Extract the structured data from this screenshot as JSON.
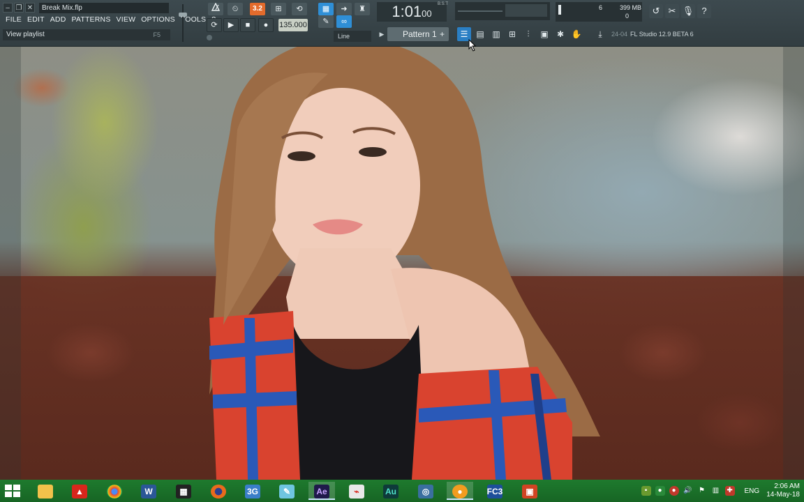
{
  "window": {
    "file_title": "Break Mix.flp",
    "ctrl_minimize": "–",
    "ctrl_restore": "❐",
    "ctrl_close": "✕"
  },
  "menu": [
    "FILE",
    "EDIT",
    "ADD",
    "PATTERNS",
    "VIEW",
    "OPTIONS",
    "TOOLS",
    "?"
  ],
  "hint": {
    "text": "View playlist",
    "shortcut": "F5"
  },
  "toolbar": {
    "tempo": "135.000",
    "snap": "Line",
    "time_main": "1:01",
    "time_ticks": "00",
    "time_sub": "B:S:T",
    "pattern": "Pattern 1",
    "pattern_plus": "+",
    "cpu_poly": "6",
    "memory": "399 MB",
    "poly_zero": "0",
    "version_date": "24-04",
    "version": "FL Studio 12.9 BETA 6",
    "overdub": "3.2"
  },
  "icons": {
    "metronome": "metronome-icon",
    "record": "record-icon",
    "play": "play-icon",
    "stop": "stop-icon",
    "loop": "loop-icon",
    "playlist": "playlist-icon"
  },
  "colors": {
    "fl_bar": "#3d4a4f",
    "accent_blue": "#2f8fd6",
    "accent_orange": "#e36b2c",
    "taskbar": "#1e7a2e"
  },
  "taskbar": {
    "apps": [
      "Explorer",
      "Acrobat",
      "Chrome",
      "Word",
      "Movie Maker",
      "Firefox",
      "3G",
      "Pen",
      "After Effects",
      "PDF",
      "Audition",
      "Network",
      "FL Studio",
      "FC3",
      "PowerPoint"
    ],
    "labels": {
      "ae": "Ae",
      "au": "Au",
      "three_g": "3G",
      "fc3": "FC3",
      "word": "W"
    },
    "lang": "ENG",
    "time": "2:06 AM",
    "date": "14-May-18"
  }
}
